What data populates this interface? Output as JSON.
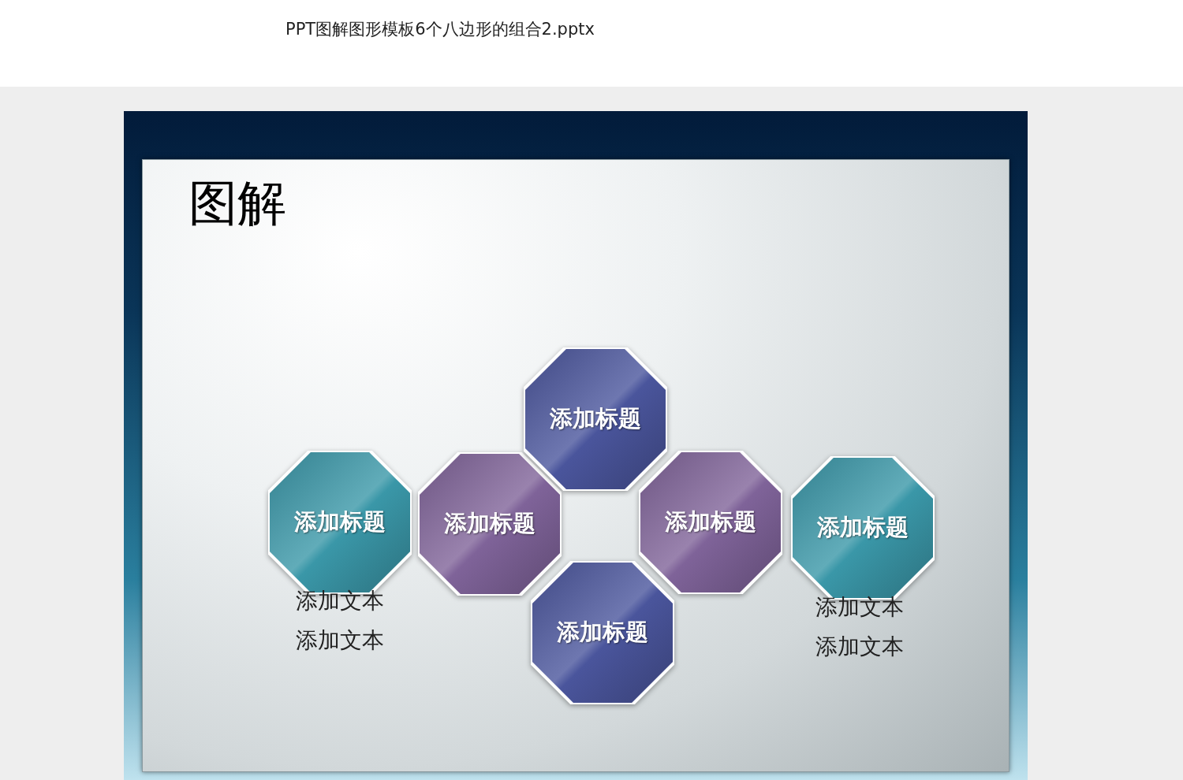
{
  "document": {
    "file_name": "PPT图解图形模板6个八边形的组合2.pptx"
  },
  "slide": {
    "title": "图解",
    "nodes": [
      {
        "label": "添加标题",
        "color": "#3a97a8"
      },
      {
        "label": "添加标题",
        "color": "#7f6399"
      },
      {
        "label": "添加标题",
        "color": "#4a559c"
      },
      {
        "label": "添加标题",
        "color": "#7f6399"
      },
      {
        "label": "添加标题",
        "color": "#3a97a8"
      },
      {
        "label": "添加标题",
        "color": "#4a559c"
      }
    ],
    "text_groups": [
      {
        "lines": [
          "添加文本",
          "添加文本"
        ]
      },
      {
        "lines": [
          "添加文本",
          "添加文本"
        ]
      }
    ]
  }
}
